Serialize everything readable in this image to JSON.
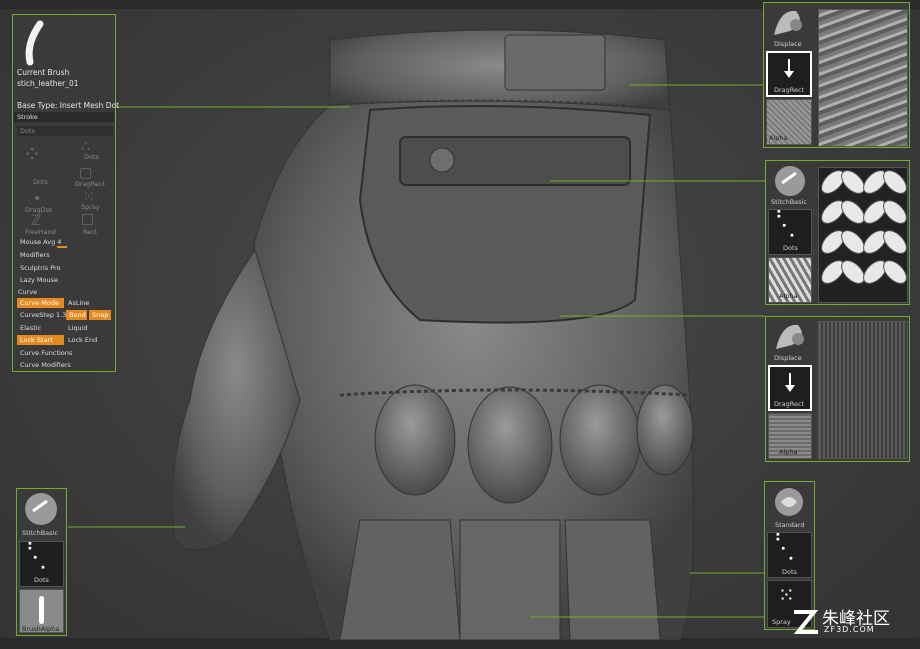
{
  "brush_panel": {
    "current_brush_label": "Current Brush",
    "brush_name": "stich_leather_01",
    "base_type": "Base Type: Insert Mesh Dot",
    "tab_stroke": "Stroke",
    "dots_field": "Dots",
    "stroke_types": [
      "Dots",
      "Dots",
      "DragRect",
      "Spray",
      "DragDot",
      "FreeHand",
      "Rect"
    ],
    "mouse_avg": "Mouse Avg 4",
    "modifiers": "Modifiers",
    "sculptris_pro": "Sculptris Pro",
    "lazy_mouse": "Lazy Mouse",
    "curve": "Curve",
    "curve_mode": "Curve Mode",
    "as_line": "AsLine",
    "curve_step": "CurveStep 1.38",
    "bend": "Bend",
    "snap": "Snap",
    "elastic": "Elastic",
    "liquid": "Liquid",
    "lock_start": "Lock Start",
    "lock_end": "Lock End",
    "curve_functions": "Curve Functions",
    "curve_modifiers": "Curve Modifiers"
  },
  "callouts": {
    "top_right": {
      "brush": "Displace",
      "stroke": "DragRect",
      "alpha": "Alpha"
    },
    "mid_right": {
      "brush": "StitchBasic",
      "stroke": "Dots",
      "alpha": "Alpha"
    },
    "low_right": {
      "brush": "Displace",
      "stroke": "DragRect",
      "alpha": "Alpha"
    },
    "bottom_left": {
      "brush": "StitchBasic",
      "stroke": "Dots",
      "alpha": "BrushAlpha"
    },
    "bottom_right": {
      "brush": "Standard",
      "stroke": "Dots",
      "alpha": "Spray"
    }
  },
  "watermark": {
    "cn": "朱峰社区",
    "en": "ZF3D.COM"
  },
  "colors": {
    "accent_green": "#6fae2f",
    "active_orange": "#e58a1f"
  },
  "icons": [
    "brush-stroke-icon",
    "dots-stroke-icon",
    "drag-rect-icon",
    "spray-icon",
    "freehand-icon",
    "displace-brush-icon",
    "sphere-brush-icon"
  ]
}
